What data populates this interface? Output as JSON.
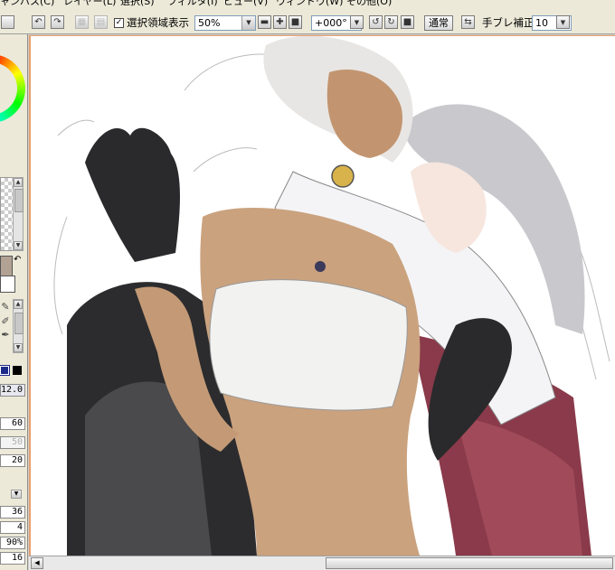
{
  "menubar": {
    "items": [
      "ャンバス(C)",
      "レイヤー(L)",
      "選択(S)",
      "フィルタ(I)",
      "ビュー(V)",
      "ウィンドウ(W)",
      "その他(O)"
    ]
  },
  "toolbar": {
    "show_selection_label": "選択領域表示",
    "show_selection_checked": "✓",
    "zoom_value": "50%",
    "rotation_value": "+000°",
    "blend_mode_label": "通常",
    "stabilizer_label": "手ブレ補正",
    "stabilizer_value": "10"
  },
  "left_panel": {
    "brush_size": "12.0",
    "density": "60",
    "dim_value": "50",
    "blending": "20",
    "param_a": "36",
    "param_b": "4",
    "param_c": "90%",
    "param_d": "16"
  },
  "colors": {
    "panel_bg": "#ece9d8",
    "canvas_border": "#e7a070",
    "foreground_color": "#b2a293",
    "background_color": "#ffffff"
  },
  "icons": {
    "undo": "undo-icon",
    "redo": "redo-icon",
    "zoom_out": "minus-icon",
    "zoom_in": "plus-icon",
    "rotate_ccw": "rotate-ccw-icon",
    "rotate_cw": "rotate-cw-icon"
  }
}
